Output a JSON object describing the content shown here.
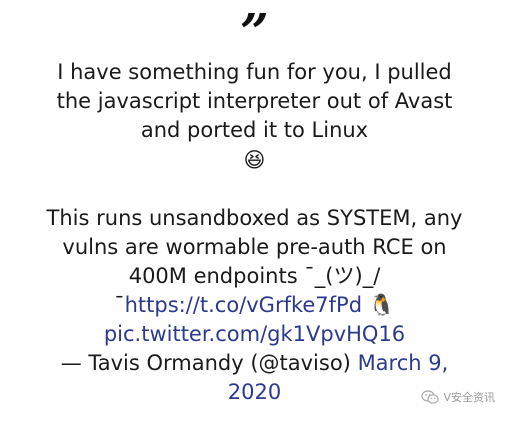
{
  "quote": {
    "mark": "”",
    "para1": "I have something fun for you, I pulled the javascript interpreter out of Avast and ported it to Linux",
    "emoji1": "😆",
    "para2_text": "This runs unsandboxed as SYSTEM, any vulns are wormable pre-auth RCE on 400M endpoints ¯_(ツ)_/¯",
    "tweet_link": "https://t.co/vGrfke7fPd",
    "emoji2": "🐧",
    "pic_link": "pic.twitter.com/gk1VpvHQ16",
    "attribution": "— Tavis Ormandy (@taviso)",
    "date": "March 9, 2020"
  },
  "watermark": {
    "text": "V安全资讯",
    "icon": "wechat-icon"
  },
  "colors": {
    "link": "#2b3a8f",
    "text": "#1a1a1a",
    "watermark": "#9a9a9a"
  }
}
